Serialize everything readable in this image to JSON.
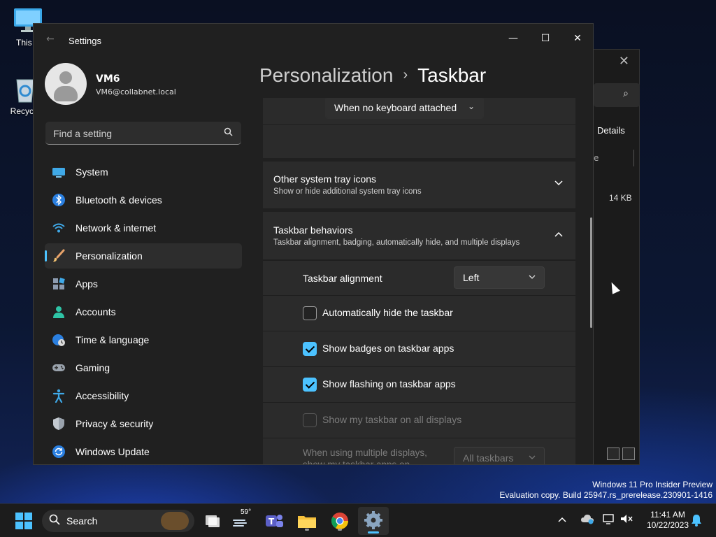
{
  "desktop": {
    "icons": [
      {
        "label": "This P",
        "icon": "computer-icon"
      },
      {
        "label": "Recycle",
        "icon": "recycle-bin-icon"
      }
    ],
    "watermark": {
      "line1": "Windows 11 Pro Insider Preview",
      "line2": "Evaluation copy. Build 25947.rs_prerelease.230901-1416"
    }
  },
  "background_window": {
    "close_glyph": "✕",
    "details_label": "Details",
    "column_fragment": "e",
    "file_size": "14 KB"
  },
  "settings": {
    "app_title": "Settings",
    "window_controls": {
      "minimize": "—",
      "maximize": "☐",
      "close": "✕"
    },
    "user": {
      "name": "VM6",
      "email": "VM6@collabnet.local"
    },
    "search": {
      "placeholder": "Find a setting"
    },
    "nav": [
      {
        "label": "System",
        "icon": "system-icon"
      },
      {
        "label": "Bluetooth & devices",
        "icon": "bluetooth-icon"
      },
      {
        "label": "Network & internet",
        "icon": "wifi-icon"
      },
      {
        "label": "Personalization",
        "icon": "brush-icon",
        "active": true
      },
      {
        "label": "Apps",
        "icon": "apps-icon"
      },
      {
        "label": "Accounts",
        "icon": "person-icon"
      },
      {
        "label": "Time & language",
        "icon": "globe-clock-icon"
      },
      {
        "label": "Gaming",
        "icon": "gamepad-icon"
      },
      {
        "label": "Accessibility",
        "icon": "accessibility-icon"
      },
      {
        "label": "Privacy & security",
        "icon": "shield-icon"
      },
      {
        "label": "Windows Update",
        "icon": "update-icon"
      }
    ],
    "breadcrumb": {
      "parent": "Personalization",
      "separator": "›",
      "current": "Taskbar"
    },
    "content": {
      "keyboard_dropdown": "When no keyboard attached",
      "other_tray": {
        "title": "Other system tray icons",
        "subtitle": "Show or hide additional system tray icons"
      },
      "behaviors": {
        "title": "Taskbar behaviors",
        "subtitle": "Taskbar alignment, badging, automatically hide, and multiple displays",
        "alignment_label": "Taskbar alignment",
        "alignment_value": "Left",
        "options": [
          {
            "label": "Automatically hide the taskbar",
            "checked": false,
            "enabled": true
          },
          {
            "label": "Show badges on taskbar apps",
            "checked": true,
            "enabled": true
          },
          {
            "label": "Show flashing on taskbar apps",
            "checked": true,
            "enabled": true
          },
          {
            "label": "Show my taskbar on all displays",
            "checked": false,
            "enabled": false
          }
        ],
        "multi_display_label_line1": "When using multiple displays,",
        "multi_display_label_line2": "show my taskbar apps on",
        "multi_display_value": "All taskbars"
      }
    }
  },
  "taskbar": {
    "search_label": "Search",
    "weather_temp": "59°",
    "time": "11:41 AM",
    "date": "10/22/2023",
    "apps": [
      "start-icon",
      "task-view-icon",
      "widgets-icon",
      "teams-icon",
      "file-explorer-icon",
      "chrome-icon",
      "settings-app-icon"
    ]
  },
  "colors": {
    "accent": "#4cc2ff",
    "window_bg": "#202020",
    "card_bg": "#2b2b2b",
    "taskbar_bg": "#1c1c1c"
  }
}
